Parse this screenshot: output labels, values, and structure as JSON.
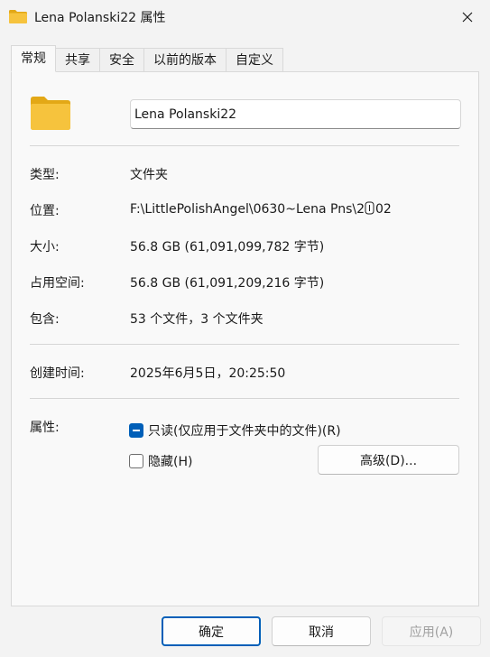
{
  "window": {
    "title": "Lena Polanski22 属性",
    "folder_icon": "folder-icon",
    "close_icon": "close-icon"
  },
  "tabs": [
    {
      "label": "常规",
      "active": true
    },
    {
      "label": "共享",
      "active": false
    },
    {
      "label": "安全",
      "active": false
    },
    {
      "label": "以前的版本",
      "active": false
    },
    {
      "label": "自定义",
      "active": false
    }
  ],
  "general": {
    "name_value": "Lena Polanski22",
    "type_label": "类型:",
    "type_value": "文件夹",
    "location_label": "位置:",
    "location_value_a": "F:\\LittlePolishAngel\\0630~Lena Pns\\2",
    "location_value_b": "02",
    "size_label": "大小:",
    "size_value": "56.8 GB (61,091,099,782 字节)",
    "disk_size_label": "占用空间:",
    "disk_size_value": "56.8 GB (61,091,209,216 字节)",
    "contains_label": "包含:",
    "contains_value": "53 个文件，3 个文件夹",
    "created_label": "创建时间:",
    "created_value": "2025年6月5日，20:25:50",
    "attributes_label": "属性:",
    "readonly_label": "只读(仅应用于文件夹中的文件)(R)",
    "readonly_state": "indeterminate",
    "hidden_label": "隐藏(H)",
    "hidden_state": "unchecked",
    "advanced_label": "高级(D)..."
  },
  "footer": {
    "ok_label": "确定",
    "cancel_label": "取消",
    "apply_label": "应用(A)",
    "apply_enabled": false
  },
  "colors": {
    "accent": "#005fb8",
    "folder_yellow": "#f6c33d",
    "folder_dark": "#e3a816"
  }
}
